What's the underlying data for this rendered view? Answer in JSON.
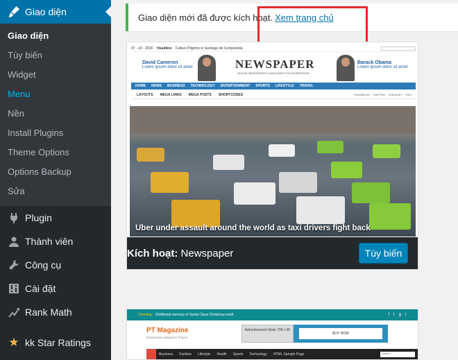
{
  "sidebar": {
    "top_item": {
      "label": "Giao diện",
      "icon": "paintbrush-icon"
    },
    "submenu": [
      {
        "label": "Giao diện",
        "state": "current"
      },
      {
        "label": "Tùy biến",
        "state": ""
      },
      {
        "label": "Widget",
        "state": ""
      },
      {
        "label": "Menu",
        "state": "active"
      },
      {
        "label": "Nền",
        "state": ""
      },
      {
        "label": "Install Plugins",
        "state": ""
      },
      {
        "label": "Theme Options",
        "state": ""
      },
      {
        "label": "Options Backup",
        "state": ""
      },
      {
        "label": "Sửa",
        "state": ""
      }
    ],
    "items": [
      {
        "label": "Plugin",
        "icon": "plugin-icon",
        "glyph": "🔌"
      },
      {
        "label": "Thành viên",
        "icon": "users-icon",
        "glyph": "👤"
      },
      {
        "label": "Công cụ",
        "icon": "wrench-icon",
        "glyph": "🔧"
      },
      {
        "label": "Cài đặt",
        "icon": "settings-icon",
        "glyph": "⚙"
      },
      {
        "label": "Rank Math",
        "icon": "rank-math-icon",
        "glyph": "📈"
      },
      {
        "label": "kk Star Ratings",
        "icon": "star-icon",
        "glyph": "★"
      }
    ]
  },
  "notice": {
    "text": "Giao diện mới đã được kích hoạt.",
    "link": "Xem trang chủ"
  },
  "active_theme": {
    "status_label": "Kích hoạt:",
    "name": "Newspaper",
    "customize_button": "Tùy biến",
    "screenshot": {
      "date": "07 - 19 - 2016",
      "headline_label": "Headline:",
      "headline": "Culture Pilgrims in Santiago de Compostela",
      "logo": "NEWSPAPER",
      "tagline": "ONLINE NEWSPAPER & MAGAZINE FOR WORDPRESS",
      "person_left": {
        "name": "David Cameron",
        "sub": "Lorem ipsum dolor sit amet"
      },
      "person_right": {
        "name": "Barack Obama",
        "sub": "Lorem ipsum dolor sit amet"
      },
      "nav": [
        "HOME",
        "NEWS",
        "BUSINESS",
        "TECHNOLOGY",
        "ENTERTAINMENT",
        "SPORTS",
        "LIFESTYLE",
        "TRAVEL"
      ],
      "subnav": [
        "LAYOUTS",
        "MEGA LINKS",
        "MEGA POSTS",
        "SHORTCODES"
      ],
      "social": [
        "FACEBOOK",
        "TWITTER",
        "GOOGLE+",
        "RSS"
      ],
      "caption": "Uber under assault around the world as taxi drivers fight back"
    }
  },
  "second_theme": {
    "trending_label": "Trending:",
    "trending_text": "Childhood memory of Santa Claus Christmas motif",
    "logo": "PT Magazine",
    "tagline": "Responsive Magazine Theme",
    "ad_text": "Advertisement block 728 x 90",
    "ad2_text": "BUY NOW",
    "nav": [
      "Business",
      "Fashion",
      "Lifestyle",
      "Health",
      "Sports",
      "Technology",
      "HTML Sample Page"
    ],
    "search_placeholder": "Search..."
  },
  "colors": {
    "sidebar_bg": "#23282d",
    "active_menu": "#0073aa",
    "notice_border": "#46b450",
    "highlight": "#e52a2a",
    "button": "#0085ba"
  }
}
